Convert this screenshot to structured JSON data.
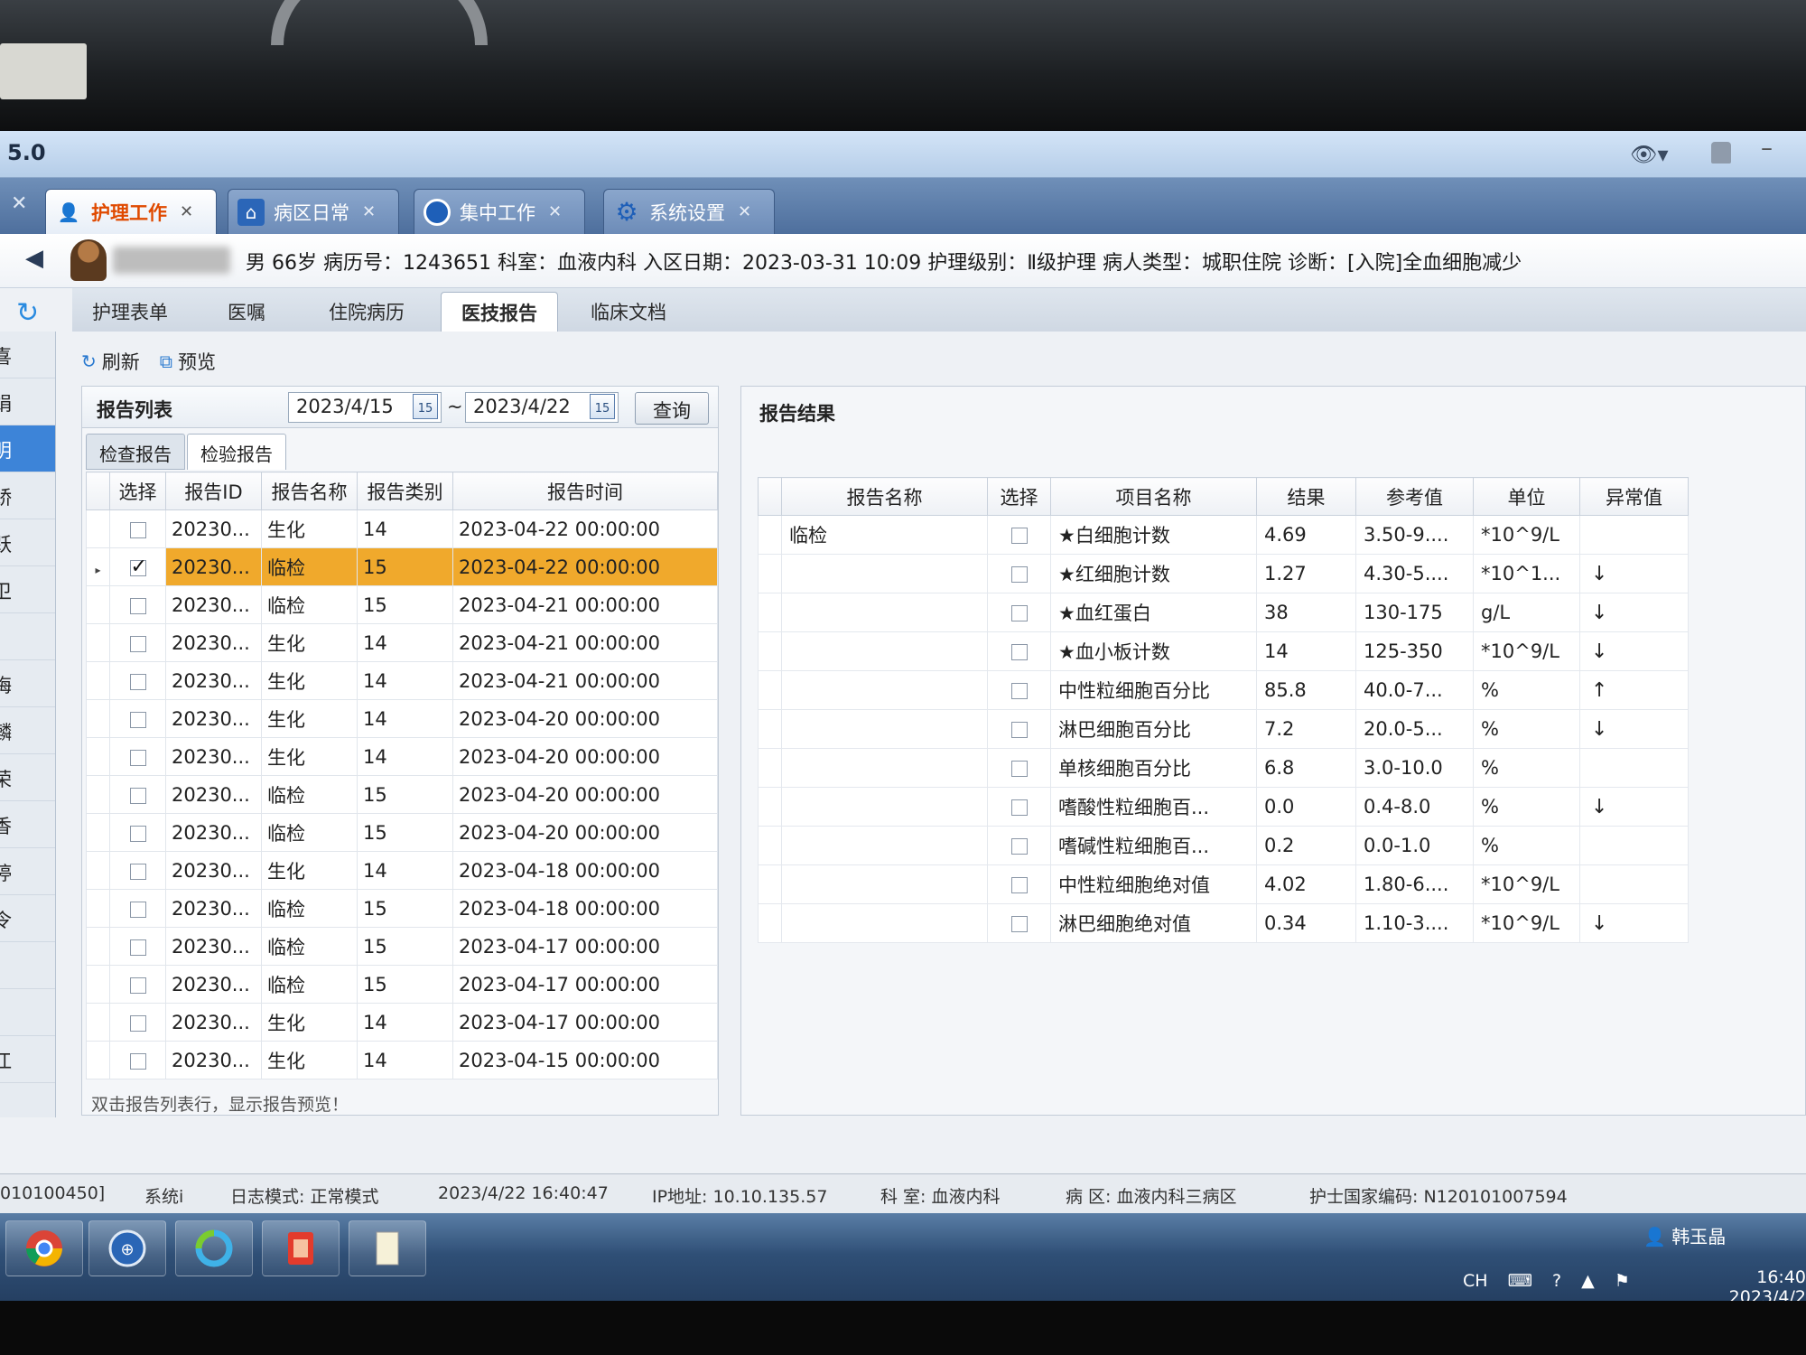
{
  "app": {
    "version": "5.0"
  },
  "tabs": [
    {
      "label": "护理工作",
      "icon": "nurse-icon",
      "active": true
    },
    {
      "label": "病区日常",
      "icon": "ward-map-icon",
      "active": false
    },
    {
      "label": "集中工作",
      "icon": "circle-icon",
      "active": false
    },
    {
      "label": "系统设置",
      "icon": "gear-icon",
      "active": false
    }
  ],
  "patient": {
    "info": "男  66岁   病历号：1243651   科室：血液内科   入区日期：2023-03-31 10:09   护理级别：Ⅱ级护理   病人类型：城职住院   诊断：[入院]全血细胞减少"
  },
  "sub_tabs": [
    "护理表单",
    "医嘱",
    "住院病历",
    "医技报告",
    "临床文档"
  ],
  "left_names": [
    "喜",
    "娟",
    "明",
    "娇",
    "跃",
    "卫",
    "",
    "梅",
    "麟",
    "荣",
    "香",
    "婷",
    "令",
    "",
    "",
    "江"
  ],
  "toolbar": {
    "refresh": "刷新",
    "preview": "预览"
  },
  "report_list": {
    "title": "报告列表",
    "date_from": "2023/4/15",
    "date_to": "2023/4/22",
    "date_sep": "~",
    "date_btn": "15",
    "query": "查询",
    "tab_check": "检查报告",
    "tab_lab": "检验报告",
    "columns": [
      "选择",
      "报告ID",
      "报告名称",
      "报告类别",
      "报告时间"
    ],
    "rows": [
      {
        "checked": false,
        "id": "20230...",
        "name": "生化",
        "cat": "14",
        "time": "2023-04-22 00:00:00"
      },
      {
        "checked": true,
        "id": "20230...",
        "name": "临检",
        "cat": "15",
        "time": "2023-04-22 00:00:00"
      },
      {
        "checked": false,
        "id": "20230...",
        "name": "临检",
        "cat": "15",
        "time": "2023-04-21 00:00:00"
      },
      {
        "checked": false,
        "id": "20230...",
        "name": "生化",
        "cat": "14",
        "time": "2023-04-21 00:00:00"
      },
      {
        "checked": false,
        "id": "20230...",
        "name": "生化",
        "cat": "14",
        "time": "2023-04-21 00:00:00"
      },
      {
        "checked": false,
        "id": "20230...",
        "name": "生化",
        "cat": "14",
        "time": "2023-04-20 00:00:00"
      },
      {
        "checked": false,
        "id": "20230...",
        "name": "生化",
        "cat": "14",
        "time": "2023-04-20 00:00:00"
      },
      {
        "checked": false,
        "id": "20230...",
        "name": "临检",
        "cat": "15",
        "time": "2023-04-20 00:00:00"
      },
      {
        "checked": false,
        "id": "20230...",
        "name": "临检",
        "cat": "15",
        "time": "2023-04-20 00:00:00"
      },
      {
        "checked": false,
        "id": "20230...",
        "name": "生化",
        "cat": "14",
        "time": "2023-04-18 00:00:00"
      },
      {
        "checked": false,
        "id": "20230...",
        "name": "临检",
        "cat": "15",
        "time": "2023-04-18 00:00:00"
      },
      {
        "checked": false,
        "id": "20230...",
        "name": "临检",
        "cat": "15",
        "time": "2023-04-17 00:00:00"
      },
      {
        "checked": false,
        "id": "20230...",
        "name": "临检",
        "cat": "15",
        "time": "2023-04-17 00:00:00"
      },
      {
        "checked": false,
        "id": "20230...",
        "name": "生化",
        "cat": "14",
        "time": "2023-04-17 00:00:00"
      },
      {
        "checked": false,
        "id": "20230...",
        "name": "生化",
        "cat": "14",
        "time": "2023-04-15 00:00:00"
      }
    ],
    "selected_index": 1,
    "hint": "双击报告列表行，显示报告预览！"
  },
  "report_result": {
    "title": "报告结果",
    "columns": [
      "报告名称",
      "选择",
      "项目名称",
      "结果",
      "参考值",
      "单位",
      "异常值"
    ],
    "report_name": "临检",
    "rows": [
      {
        "item": "★白细胞计数",
        "result": "4.69",
        "ref": "3.50-9....",
        "unit": "*10^9/L",
        "flag": ""
      },
      {
        "item": "★红细胞计数",
        "result": "1.27",
        "ref": "4.30-5....",
        "unit": "*10^1...",
        "flag": "↓"
      },
      {
        "item": "★血红蛋白",
        "result": "38",
        "ref": "130-175",
        "unit": "g/L",
        "flag": "↓"
      },
      {
        "item": "★血小板计数",
        "result": "14",
        "ref": "125-350",
        "unit": "*10^9/L",
        "flag": "↓"
      },
      {
        "item": "中性粒细胞百分比",
        "result": "85.8",
        "ref": "40.0-7...",
        "unit": "%",
        "flag": "↑"
      },
      {
        "item": "淋巴细胞百分比",
        "result": "7.2",
        "ref": "20.0-5...",
        "unit": "%",
        "flag": "↓"
      },
      {
        "item": "单核细胞百分比",
        "result": "6.8",
        "ref": "3.0-10.0",
        "unit": "%",
        "flag": ""
      },
      {
        "item": "嗜酸性粒细胞百...",
        "result": "0.0",
        "ref": "0.4-8.0",
        "unit": "%",
        "flag": "↓"
      },
      {
        "item": "嗜碱性粒细胞百...",
        "result": "0.2",
        "ref": "0.0-1.0",
        "unit": "%",
        "flag": ""
      },
      {
        "item": "中性粒细胞绝对值",
        "result": "4.02",
        "ref": "1.80-6....",
        "unit": "*10^9/L",
        "flag": ""
      },
      {
        "item": "淋巴细胞绝对值",
        "result": "0.34",
        "ref": "1.10-3....",
        "unit": "*10^9/L",
        "flag": "↓"
      }
    ]
  },
  "statusbar": {
    "code": "010100450]",
    "system": "系统i",
    "log_mode": "日志模式: 正常模式",
    "datetime": "2023/4/22 16:40:47",
    "ip": "IP地址: 10.10.135.57",
    "dept": "科 室: 血液内科",
    "ward": "病 区: 血液内科三病区",
    "nurse_code": "护士国家编码: N120101007594",
    "user": "韩玉晶"
  },
  "taskbar": {
    "lang": "CH",
    "time": "16:40",
    "date": "2023/4/2"
  },
  "colors": {
    "selected_row": "#f0a92c",
    "active_tab_text": "#e04a00",
    "taskbar": "#2f4f76"
  }
}
